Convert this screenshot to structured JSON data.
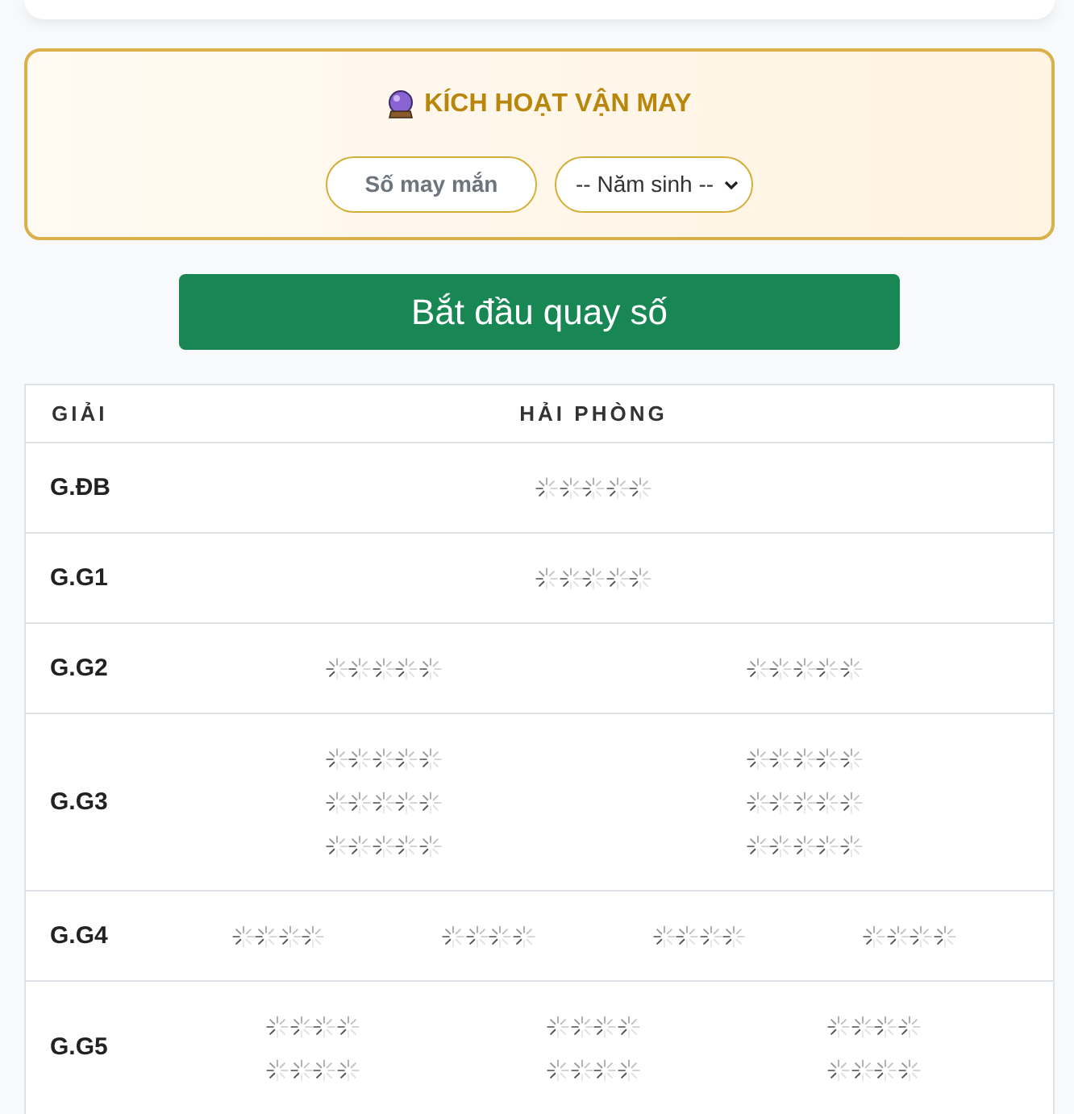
{
  "lucky_panel": {
    "title": "KÍCH HOẠT VẬN MAY",
    "lucky_button": "Số may mắn",
    "birth_year_select": {
      "value": "-- Năm sinh --"
    }
  },
  "start_button": "Bắt đầu quay số",
  "results_table": {
    "columns": [
      "GIẢI",
      "HẢI PHÒNG"
    ],
    "rows": [
      {
        "prize": "G.ĐB",
        "lines": [
          {
            "numbers": [
              {
                "digits": [
                  {
                    "loading": true
                  },
                  {
                    "loading": true
                  },
                  {
                    "loading": true
                  },
                  {
                    "loading": true
                  },
                  {
                    "loading": true
                  }
                ]
              }
            ]
          }
        ]
      },
      {
        "prize": "G.G1",
        "lines": [
          {
            "numbers": [
              {
                "digits": [
                  {
                    "loading": true
                  },
                  {
                    "loading": true
                  },
                  {
                    "loading": true
                  },
                  {
                    "loading": true
                  },
                  {
                    "loading": true
                  }
                ]
              }
            ]
          }
        ]
      },
      {
        "prize": "G.G2",
        "lines": [
          {
            "numbers": [
              {
                "digits": [
                  {
                    "loading": true
                  },
                  {
                    "loading": true
                  },
                  {
                    "loading": true
                  },
                  {
                    "loading": true
                  },
                  {
                    "loading": true
                  }
                ]
              },
              {
                "digits": [
                  {
                    "loading": true
                  },
                  {
                    "loading": true
                  },
                  {
                    "loading": true
                  },
                  {
                    "loading": true
                  },
                  {
                    "loading": true
                  }
                ]
              }
            ]
          }
        ]
      },
      {
        "prize": "G.G3",
        "lines": [
          {
            "numbers": [
              {
                "digits": [
                  {
                    "loading": true
                  },
                  {
                    "loading": true
                  },
                  {
                    "loading": true
                  },
                  {
                    "loading": true
                  },
                  {
                    "loading": true
                  }
                ]
              },
              {
                "digits": [
                  {
                    "loading": true
                  },
                  {
                    "loading": true
                  },
                  {
                    "loading": true
                  },
                  {
                    "loading": true
                  },
                  {
                    "loading": true
                  }
                ]
              }
            ]
          },
          {
            "numbers": [
              {
                "digits": [
                  {
                    "loading": true
                  },
                  {
                    "loading": true
                  },
                  {
                    "loading": true
                  },
                  {
                    "loading": true
                  },
                  {
                    "loading": true
                  }
                ]
              },
              {
                "digits": [
                  {
                    "loading": true
                  },
                  {
                    "loading": true
                  },
                  {
                    "loading": true
                  },
                  {
                    "loading": true
                  },
                  {
                    "loading": true
                  }
                ]
              }
            ]
          },
          {
            "numbers": [
              {
                "digits": [
                  {
                    "loading": true
                  },
                  {
                    "loading": true
                  },
                  {
                    "loading": true
                  },
                  {
                    "loading": true
                  },
                  {
                    "loading": true
                  }
                ]
              },
              {
                "digits": [
                  {
                    "loading": true
                  },
                  {
                    "loading": true
                  },
                  {
                    "loading": true
                  },
                  {
                    "loading": true
                  },
                  {
                    "loading": true
                  }
                ]
              }
            ]
          }
        ]
      },
      {
        "prize": "G.G4",
        "lines": [
          {
            "numbers": [
              {
                "digits": [
                  {
                    "loading": true
                  },
                  {
                    "loading": true
                  },
                  {
                    "loading": true
                  },
                  {
                    "loading": true
                  }
                ]
              },
              {
                "digits": [
                  {
                    "loading": true
                  },
                  {
                    "loading": true
                  },
                  {
                    "loading": true
                  },
                  {
                    "loading": true
                  }
                ]
              },
              {
                "digits": [
                  {
                    "loading": true
                  },
                  {
                    "loading": true
                  },
                  {
                    "loading": true
                  },
                  {
                    "loading": true
                  }
                ]
              },
              {
                "digits": [
                  {
                    "loading": true
                  },
                  {
                    "loading": true
                  },
                  {
                    "loading": true
                  },
                  {
                    "loading": true
                  }
                ]
              }
            ]
          }
        ]
      },
      {
        "prize": "G.G5",
        "lines": [
          {
            "numbers": [
              {
                "digits": [
                  {
                    "loading": true
                  },
                  {
                    "loading": true
                  },
                  {
                    "loading": true
                  },
                  {
                    "loading": true
                  }
                ]
              },
              {
                "digits": [
                  {
                    "loading": true
                  },
                  {
                    "loading": true
                  },
                  {
                    "loading": true
                  },
                  {
                    "loading": true
                  }
                ]
              },
              {
                "digits": [
                  {
                    "loading": true
                  },
                  {
                    "loading": true
                  },
                  {
                    "loading": true
                  },
                  {
                    "loading": true
                  }
                ]
              }
            ]
          },
          {
            "numbers": [
              {
                "digits": [
                  {
                    "loading": true
                  },
                  {
                    "loading": true
                  },
                  {
                    "loading": true
                  },
                  {
                    "loading": true
                  }
                ]
              },
              {
                "digits": [
                  {
                    "loading": true
                  },
                  {
                    "loading": true
                  },
                  {
                    "loading": true
                  },
                  {
                    "loading": true
                  }
                ]
              },
              {
                "digits": [
                  {
                    "loading": true
                  },
                  {
                    "loading": true
                  },
                  {
                    "loading": true
                  },
                  {
                    "loading": true
                  }
                ]
              }
            ]
          }
        ]
      }
    ]
  }
}
